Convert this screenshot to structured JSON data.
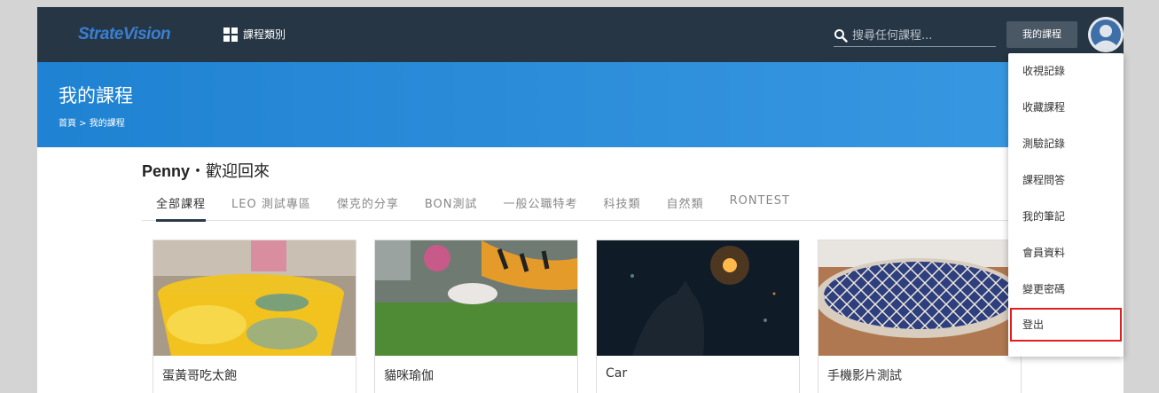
{
  "header": {
    "logo": "StrateVision",
    "category_label": "課程類別",
    "search_placeholder": "搜尋任何課程...",
    "my_courses_button": "我的課程"
  },
  "hero": {
    "title": "我的課程",
    "breadcrumb": "首頁 > 我的課程"
  },
  "welcome": {
    "name": "Penny",
    "text": "・歡迎回來"
  },
  "tabs": [
    {
      "label": "全部課程"
    },
    {
      "label": "LEO 測試專區"
    },
    {
      "label": "傑克的分享"
    },
    {
      "label": "BON測試"
    },
    {
      "label": "一般公職特考"
    },
    {
      "label": "科技類"
    },
    {
      "label": "自然類"
    },
    {
      "label": "RONTEST"
    }
  ],
  "courses": [
    {
      "title": "蛋黃哥吃太飽"
    },
    {
      "title": "貓咪瑜伽"
    },
    {
      "title": "Car"
    },
    {
      "title": "手機影片測試"
    }
  ],
  "user_menu": [
    {
      "label": "收視記錄"
    },
    {
      "label": "收藏課程"
    },
    {
      "label": "測驗記錄"
    },
    {
      "label": "課程問答"
    },
    {
      "label": "我的筆記"
    },
    {
      "label": "會員資料"
    },
    {
      "label": "變更密碼"
    },
    {
      "label": "登出"
    }
  ],
  "colors": {
    "topbar": "#263645",
    "hero": "#2a8ed9",
    "highlight": "#e02020"
  }
}
